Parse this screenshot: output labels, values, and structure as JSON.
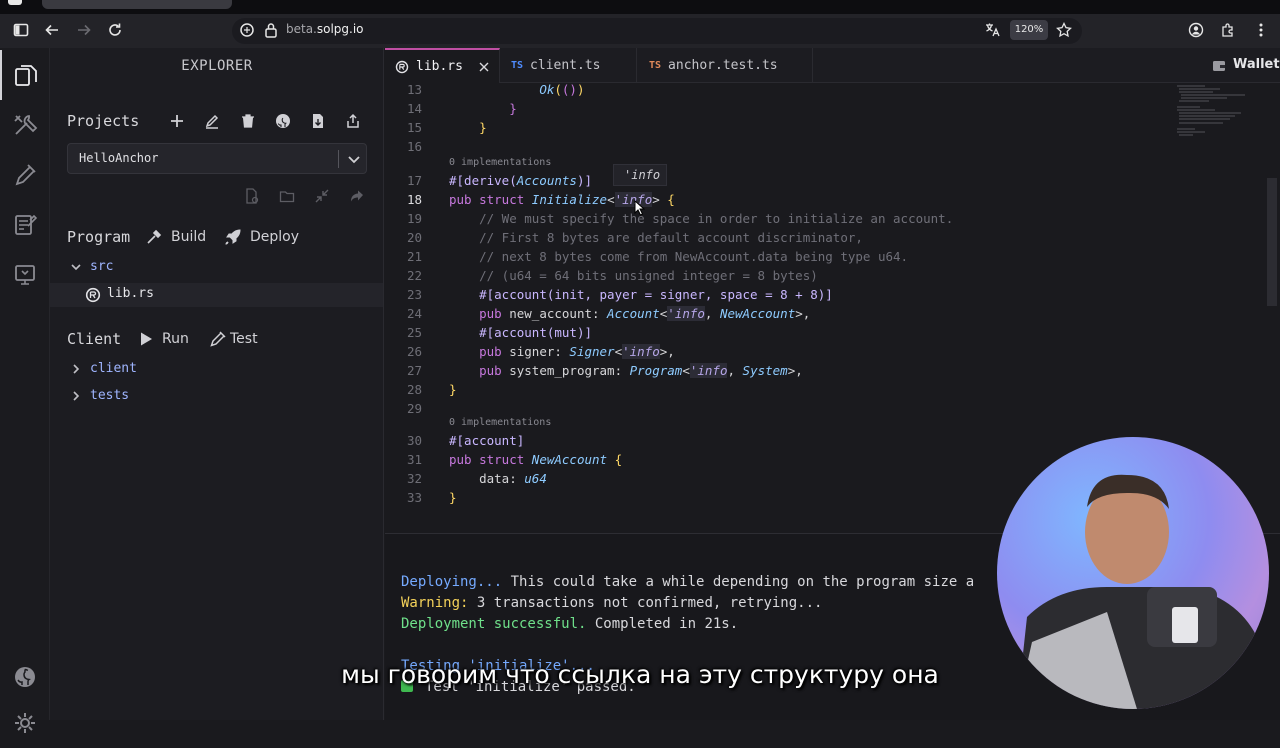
{
  "browser": {
    "url_prefix": "beta.",
    "url_domain": "solpg.io",
    "zoom": "120%"
  },
  "sidebar": {
    "title": "EXPLORER",
    "projects_label": "Projects",
    "project_selected": "HelloAnchor",
    "program_label": "Program",
    "build_label": "Build",
    "deploy_label": "Deploy",
    "src_folder": "src",
    "lib_file": "lib.rs",
    "client_label": "Client",
    "run_label": "Run",
    "test_label": "Test",
    "client_folder": "client",
    "tests_folder": "tests"
  },
  "tabs": [
    {
      "label": "lib.rs",
      "badge": ""
    },
    {
      "label": "client.ts",
      "badge": "TS"
    },
    {
      "label": "anchor.test.ts",
      "badge": "TS"
    }
  ],
  "wallet_label": "Wallet",
  "editor": {
    "implementations_label": "0 implementations",
    "hover_text": "'info",
    "line_numbers": [
      "13",
      "14",
      "15",
      "16",
      "17",
      "18",
      "19",
      "20",
      "21",
      "22",
      "23",
      "24",
      "25",
      "26",
      "27",
      "28",
      "29",
      "30",
      "31",
      "32",
      "33"
    ]
  },
  "terminal": {
    "line1_status": "Deploying...",
    "line1_rest": " This could take a while depending on the program size a",
    "line2_status": "Warning:",
    "line2_rest": " 3 transactions not confirmed, retrying...",
    "line3_status": "Deployment successful.",
    "line3_rest": " Completed in 21s.",
    "line4": "Testing 'initialize'...",
    "line5": "Test 'initialize' passed."
  },
  "subtitle": "мы говорим что ссылка на эту структуру она",
  "colors": {
    "accent": "#c04fa3",
    "ts_badge": "#4f8cff",
    "test_ts_badge": "#e0895a"
  }
}
